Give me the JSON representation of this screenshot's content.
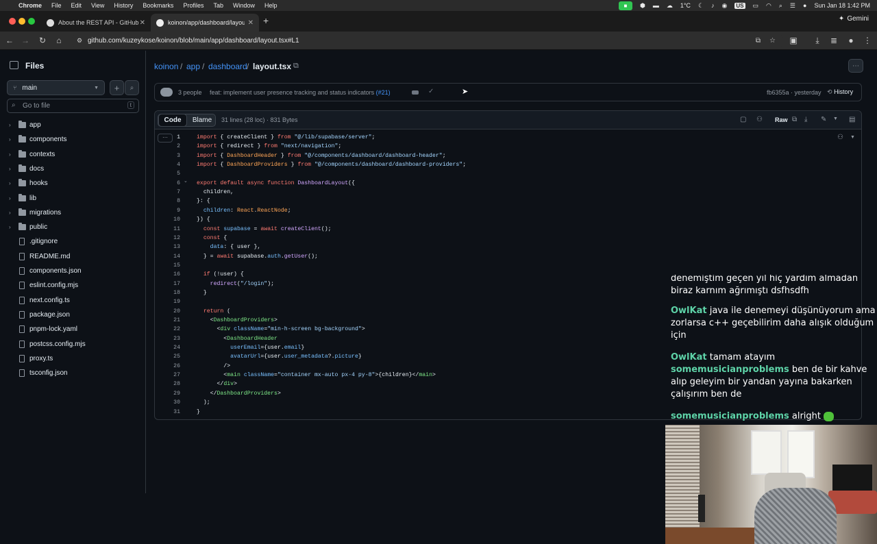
{
  "menubar": {
    "app": "Chrome",
    "items": [
      "File",
      "Edit",
      "View",
      "History",
      "Bookmarks",
      "Profiles",
      "Tab",
      "Window",
      "Help"
    ],
    "temperature": "1°C",
    "clock": "Sun Jan 18  1:42 PM",
    "keyboard": "US"
  },
  "browser": {
    "tabs": [
      {
        "title": "About the REST API - GitHub"
      },
      {
        "title": "koinon/app/dashboard/layout"
      }
    ],
    "url": "github.com/kuzeykose/koinon/blob/main/app/dashboard/layout.tsx#L1",
    "gemini_label": "Gemini"
  },
  "sidebar": {
    "title": "Files",
    "branch": "main",
    "go_to_file_placeholder": "Go to file",
    "shortcut": "t",
    "folders": [
      "app",
      "components",
      "contexts",
      "docs",
      "hooks",
      "lib",
      "migrations",
      "public"
    ],
    "files": [
      ".gitignore",
      "README.md",
      "components.json",
      "eslint.config.mjs",
      "next.config.ts",
      "package.json",
      "pnpm-lock.yaml",
      "postcss.config.mjs",
      "proxy.ts",
      "tsconfig.json"
    ]
  },
  "breadcrumb": {
    "repo": "koinon",
    "dir1": "app",
    "dir2": "dashboard",
    "file": "layout.tsx"
  },
  "commit": {
    "people": "3 people",
    "message": "feat: implement user presence tracking and status indicators ",
    "pr": "(#21)",
    "sha_time": "fb6355a · yesterday",
    "history_label": "History"
  },
  "codeview": {
    "tab_code": "Code",
    "tab_blame": "Blame",
    "meta": "31 lines (28 loc) · 831 Bytes",
    "raw_label": "Raw"
  },
  "chat": [
    {
      "user": "",
      "text": "denemiştim geçen yıl hiç yardım almadan biraz karnım ağrımıştı dsfhsdfh"
    },
    {
      "user": "OwlKat",
      "text": "java ile denemeyi düşünüyorum ama zorlarsa c++ geçebilirim daha alışık olduğum için"
    },
    {
      "user": "OwlKat",
      "text": "tamam atayım"
    },
    {
      "user": "somemusicianproblems",
      "text": "ben de bir kahve alıp geleyim bir yandan yayına bakarken çalışırım ben de"
    },
    {
      "user": "somemusicianproblems",
      "text": "alright"
    }
  ]
}
